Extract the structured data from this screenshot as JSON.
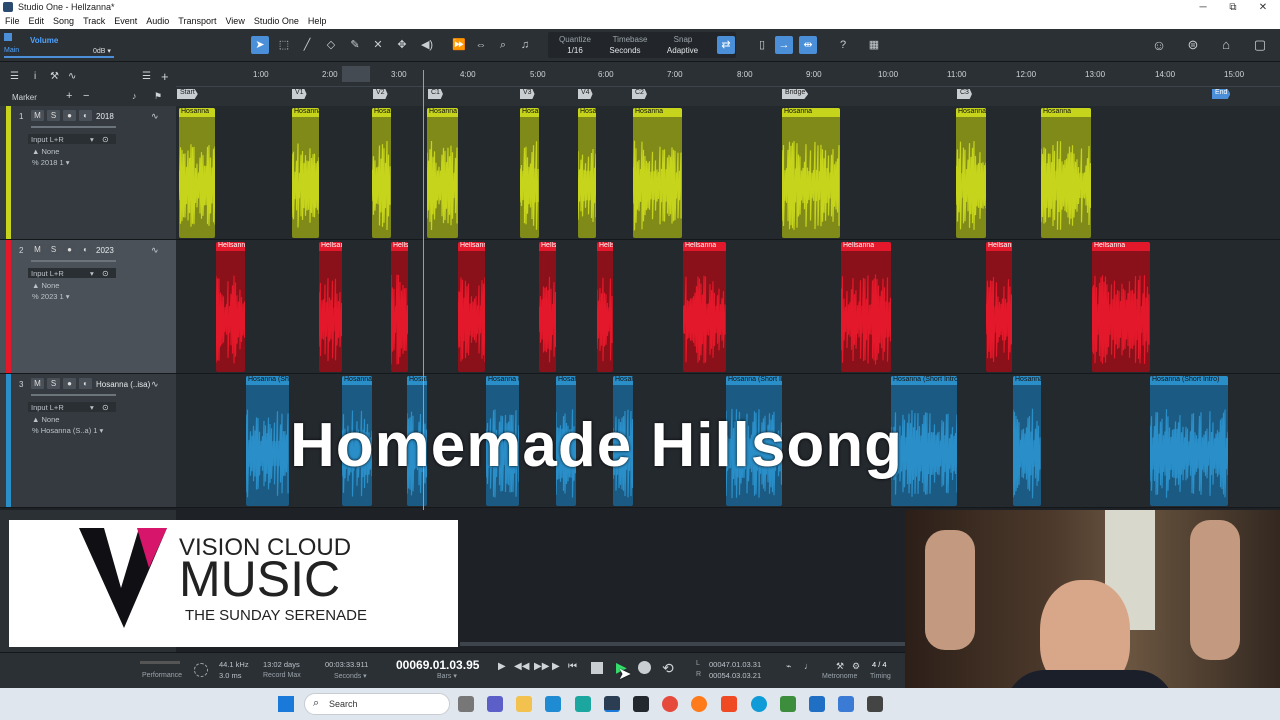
{
  "window": {
    "title": "Studio One - Hellzanna*",
    "minimize": "─",
    "maximize": "⧉",
    "close": "✕"
  },
  "menu": [
    "File",
    "Edit",
    "Song",
    "Track",
    "Event",
    "Audio",
    "Transport",
    "View",
    "Studio One",
    "Help"
  ],
  "inspector": {
    "label": "Volume",
    "sub": "Main",
    "value": "0dB ▾"
  },
  "toolbar": {
    "quantize": {
      "label": "Quantize",
      "value": "1/16"
    },
    "timebase": {
      "label": "Timebase",
      "value": "Seconds"
    },
    "snap": {
      "label": "Snap",
      "value": "Adaptive"
    },
    "help": "?"
  },
  "arrange": {
    "marker_label": "Marker"
  },
  "ruler": {
    "ticks": [
      "1:00",
      "2:00",
      "3:00",
      "4:00",
      "5:00",
      "6:00",
      "7:00",
      "8:00",
      "9:00",
      "10:00",
      "11:00",
      "12:00",
      "13:00",
      "14:00",
      "15:00"
    ]
  },
  "markers": [
    "Start",
    "V1",
    "V2",
    "C1",
    "V3",
    "V4",
    "C2",
    "Bridge",
    "C3",
    "End"
  ],
  "tracks": [
    {
      "num": "1",
      "name": "2018",
      "input": "Input L+R",
      "output": "None",
      "channel": "2018 1",
      "color": "#c6d41c",
      "clip_label": "Hosanna"
    },
    {
      "num": "2",
      "name": "2023",
      "input": "Input L+R",
      "output": "None",
      "channel": "2023 1",
      "color": "#e3182a",
      "clip_label": "Hellsanna"
    },
    {
      "num": "3",
      "name": "Hosanna (..isa)",
      "input": "Input L+R",
      "output": "None",
      "channel": "Hosanna (S..a) 1",
      "color": "#2a8fc9",
      "clip_label": "Hosanna (Short Intro)"
    }
  ],
  "track_buttons": [
    "M",
    "S",
    "●",
    "◐"
  ],
  "overlay": {
    "text": "Homemade Hillsong"
  },
  "logo": {
    "line1": "VISION CLOUD",
    "line2": "MUSIC",
    "line3": "THE SUNDAY SERENADE"
  },
  "transport": {
    "performance": "Performance",
    "rate": "44.1 kHz",
    "latency": "3.0 ms",
    "record_max_val": "13:02 days",
    "record_max": "Record Max",
    "time_seconds": "00:03:33.911",
    "seconds_label": "Seconds ▾",
    "bars_main": "00069.01.03.95",
    "bars_label": "Bars ▾",
    "loop_l": "00047.01.03.31",
    "loop_r": "00054.03.03.21",
    "metronome": "Metronome",
    "timesig": "4 / 4",
    "timing": "Timing"
  },
  "taskbar": {
    "search_placeholder": "Search"
  },
  "colors": {
    "accent": "#4a8fd8",
    "yellow": "#c6d41c",
    "red": "#e3182a",
    "blue": "#2a8fc9"
  }
}
